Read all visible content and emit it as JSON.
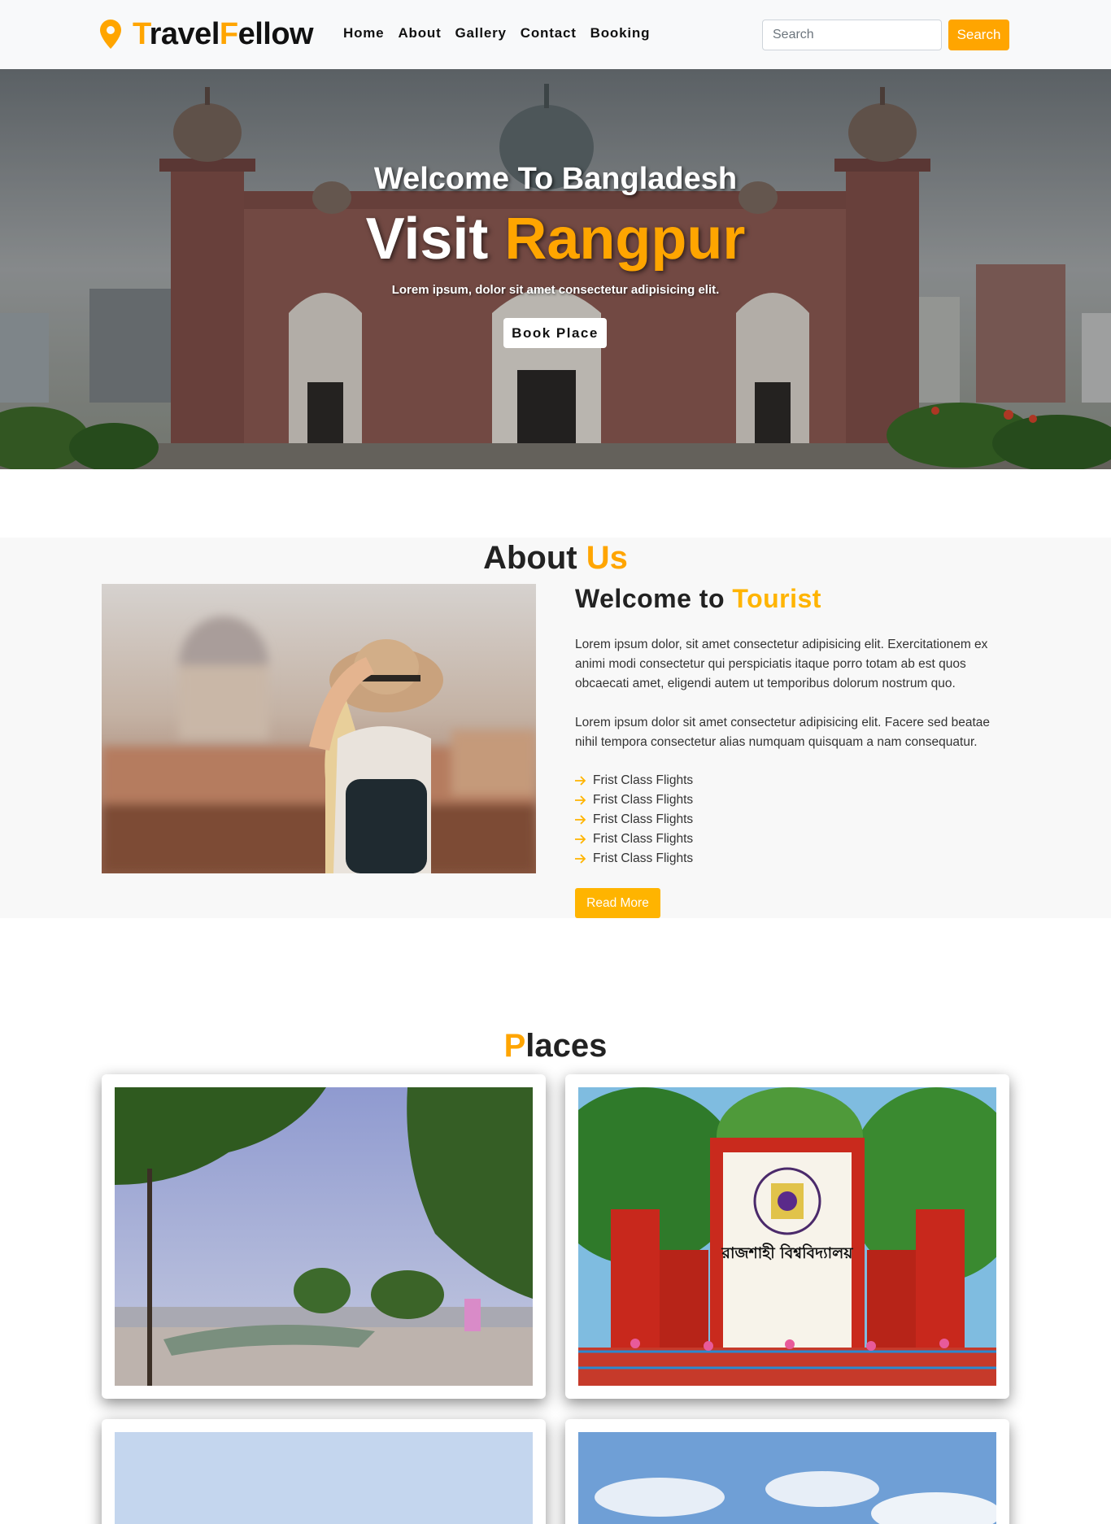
{
  "brand": {
    "prefix_first": "T",
    "part1": "ravel",
    "accent": "F",
    "part2": "ellow",
    "pin_icon": "map-pin-icon",
    "accent_color": "#ffa500"
  },
  "nav": {
    "items": [
      "Home",
      "About",
      "Gallery",
      "Contact",
      "Booking"
    ]
  },
  "search": {
    "placeholder": "Search",
    "button_label": "Search"
  },
  "hero": {
    "subtitle": "Welcome To Bangladesh",
    "title_plain": "Visit ",
    "title_accent": "Rangpur",
    "description": "Lorem ipsum, dolor sit amet consectetur adipisicing elit.",
    "button_label": "Book Place"
  },
  "about": {
    "heading_plain": "About ",
    "heading_accent": "Us",
    "title_plain": "Welcome to ",
    "title_accent": "Tourist",
    "paragraph1": "Lorem ipsum dolor, sit amet consectetur adipisicing elit. Exercitationem ex animi modi consectetur qui perspiciatis itaque porro totam ab est quos obcaecati amet, eligendi autem ut temporibus dolorum nostrum quo.",
    "paragraph2": "Lorem ipsum dolor sit amet consectetur adipisicing elit. Facere sed beatae nihil tempora consectetur alias numquam quisquam a nam consequatur.",
    "features": [
      "Frist Class Flights",
      "Frist Class Flights",
      "Frist Class Flights",
      "Frist Class Flights",
      "Frist Class Flights"
    ],
    "read_more_label": "Read More"
  },
  "places": {
    "heading_accent": "P",
    "heading_plain": "laces",
    "signboard_text": "রাজশাহী বিশ্ববিদ্যালয়"
  }
}
